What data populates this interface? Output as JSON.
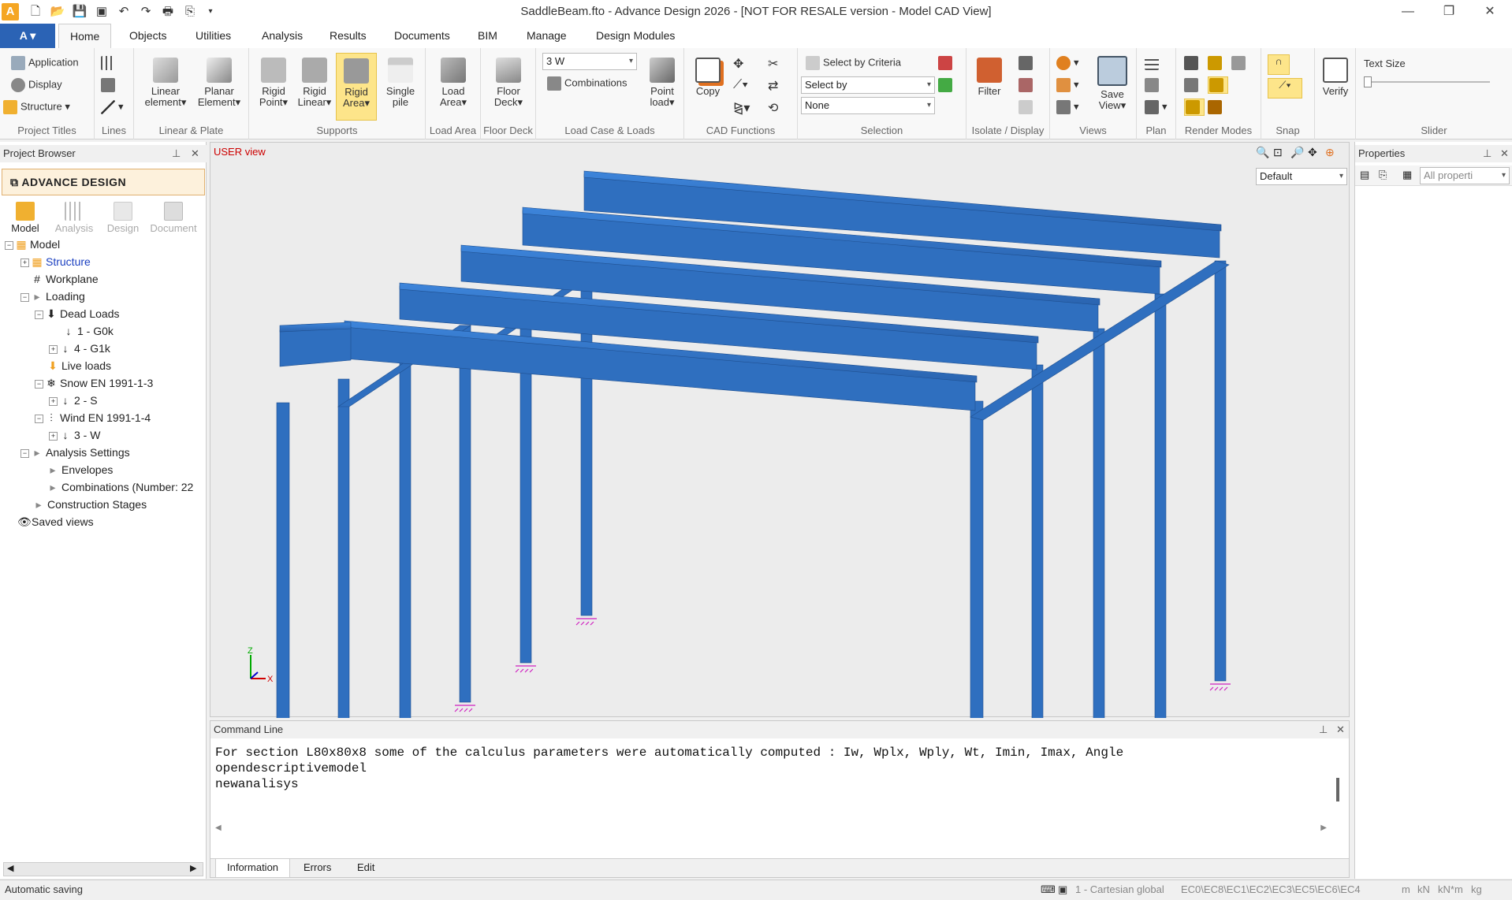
{
  "window": {
    "title": "SaddleBeam.fto - Advance Design 2026 - [NOT FOR RESALE version - Model CAD View]",
    "app_button": "A"
  },
  "menu": {
    "tabs": [
      "Home",
      "Objects",
      "Utilities",
      "Analysis",
      "Results",
      "Documents",
      "BIM",
      "Manage",
      "Design Modules"
    ]
  },
  "ribbon": {
    "project_titles": {
      "application": "Application",
      "display": "Display",
      "structure": "Structure",
      "label": "Project Titles"
    },
    "lines": {
      "label": "Lines"
    },
    "linear_plate": {
      "linear_element": "Linear element",
      "planar_element": "Planar Element",
      "label": "Linear & Plate"
    },
    "supports": {
      "rigid_point": "Rigid Point",
      "rigid_linear": "Rigid Linear",
      "rigid_area": "Rigid Area",
      "single_pile": "Single pile",
      "label": "Supports"
    },
    "load_area": {
      "btn": "Load Area",
      "label": "Load Area"
    },
    "floor_deck": {
      "btn": "Floor Deck",
      "label": "Floor Deck"
    },
    "load_case": {
      "case_value": "3 W",
      "combinations": "Combinations",
      "point_load": "Point load",
      "label": "Load Case & Loads"
    },
    "cad": {
      "copy": "Copy",
      "label": "CAD Functions"
    },
    "selection": {
      "select_criteria": "Select by Criteria",
      "select_by": "Select by",
      "none": "None",
      "label": "Selection"
    },
    "isolate": {
      "filter": "Filter",
      "label": "Isolate / Display"
    },
    "views": {
      "save_view": "Save View",
      "label": "Views"
    },
    "plan": {
      "label": "Plan"
    },
    "render": {
      "label": "Render Modes"
    },
    "snap": {
      "label": "Snap"
    },
    "verify": {
      "btn": "Verify"
    },
    "slider": {
      "text_size": "Text Size",
      "label": "Slider"
    }
  },
  "browser": {
    "title": "Project Browser",
    "brand": "ADVANCE DESIGN",
    "tabs": [
      "Model",
      "Analysis",
      "Design",
      "Document"
    ],
    "tree": [
      "Model",
      "Structure",
      "Workplane",
      "Loading",
      "Dead Loads",
      "1 - G0k",
      "4 - G1k",
      "Live loads",
      "Snow EN 1991-1-3",
      "2 - S",
      "Wind EN 1991-1-4",
      "3 - W",
      "Analysis Settings",
      "Envelopes",
      "Combinations (Number: 22",
      "Construction Stages",
      "Saved views"
    ]
  },
  "viewport": {
    "label": "USER view",
    "view_combo": "Default",
    "axis_z": "Z",
    "axis_x": "X"
  },
  "command": {
    "title": "Command Line",
    "lines": [
      "For section L80x80x8 some of the calculus parameters were automatically computed : Iw, Wplx, Wply, Wt, Imin, Imax, Angle",
      "opendescriptivemodel",
      "newanalisys"
    ],
    "tabs": [
      "Information",
      "Errors",
      "Edit"
    ]
  },
  "properties": {
    "title": "Properties",
    "filter": "All properti"
  },
  "status": {
    "left": "Automatic saving",
    "coord": "1 - Cartesian global",
    "codes": "EC0\\EC8\\EC1\\EC2\\EC3\\EC5\\EC6\\EC4",
    "units": [
      "m",
      "kN",
      "kN*m",
      "kg"
    ]
  },
  "colors": {
    "steel": "#2f6fbf",
    "steel_top": "#3a7fd4",
    "accent": "#2b63b5",
    "support": "#d020c0"
  }
}
